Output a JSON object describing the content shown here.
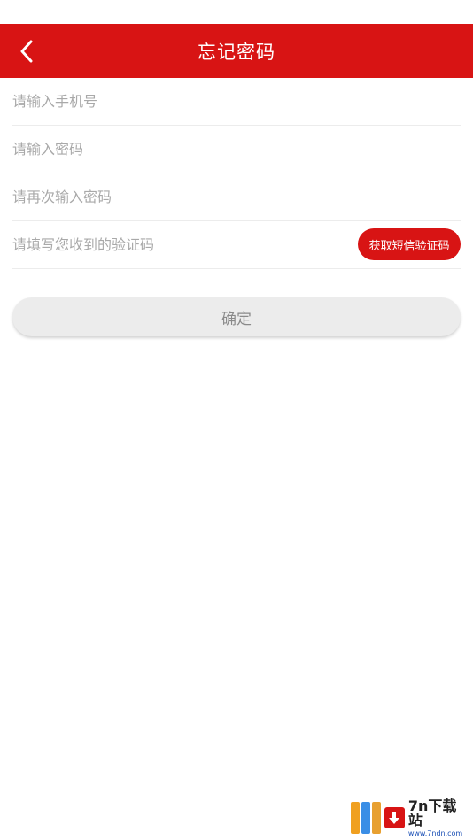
{
  "header": {
    "title": "忘记密码"
  },
  "form": {
    "phone_placeholder": "请输入手机号",
    "password_placeholder": "请输入密码",
    "confirm_password_placeholder": "请再次输入密码",
    "code_placeholder": "请填写您收到的验证码",
    "sms_button_label": "获取短信验证码"
  },
  "confirm_button_label": "确定",
  "watermark": {
    "main": "7n下载站",
    "sub": "www.7ndn.com"
  },
  "colors": {
    "primary": "#d81414",
    "disabled_button": "#ececec",
    "placeholder": "#a9a9a9"
  }
}
